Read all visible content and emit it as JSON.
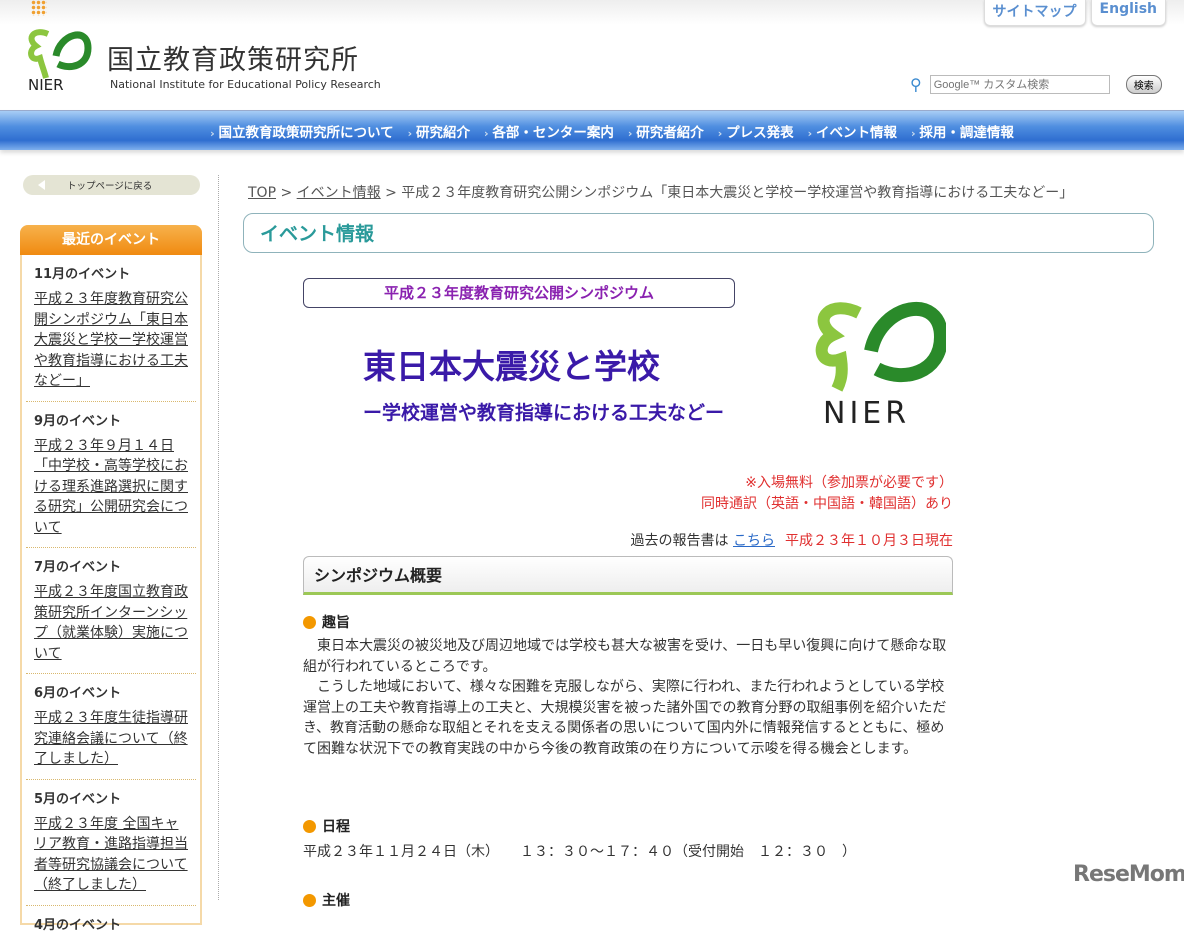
{
  "header": {
    "org_jp": "国立教育政策研究所",
    "org_en": "National Institute for Educational Policy Research",
    "logo_text": "NIER",
    "top_links": [
      "サイトマップ",
      "English"
    ],
    "search": {
      "placeholder": "Google™ カスタム検索",
      "button": "検索"
    }
  },
  "nav": [
    "国立教育政策研究所について",
    "研究紹介",
    "各部・センター案内",
    "研究者紹介",
    "プレス発表",
    "イベント情報",
    "採用・調達情報"
  ],
  "sidebar": {
    "back": "トップページに戻る",
    "events_title": "最近のイベント",
    "events": [
      {
        "month": "11月のイベント",
        "title": "平成２３年度教育研究公開シンポジウム「東日本大震災と学校ー学校運営や教育指導における工夫などー」"
      },
      {
        "month": "9月のイベント",
        "title": "平成２３年９月１４日「中学校・高等学校における理系進路選択に関する研究」公開研究会について"
      },
      {
        "month": "7月のイベント",
        "title": "平成２３年度国立教育政策研究所インターンシップ（就業体験）実施について"
      },
      {
        "month": "6月のイベント",
        "title": "平成２３年度生徒指導研究連絡会議について（終了しました）"
      },
      {
        "month": "5月のイベント",
        "title": "平成２３年度 全国キャリア教育・進路指導担当者等研究協議会について（終了しました）"
      },
      {
        "month": "4月のイベント",
        "title": ""
      }
    ]
  },
  "breadcrumb": {
    "top": "TOP",
    "events": "イベント情報",
    "current": "平成２３年度教育研究公開シンポジウム「東日本大震災と学校ー学校運営や教育指導における工夫などー」"
  },
  "section_title": "イベント情報",
  "banner": {
    "subtitle": "平成２３年度教育研究公開シンポジウム",
    "title": "東日本大震災と学校",
    "title2": "ー学校運営や教育指導における工夫などー",
    "logo_text": "NIER"
  },
  "notes": [
    "※入場無料（参加票が必要です）",
    "同時通訳（英語・中国語・韓国語）あり"
  ],
  "past": {
    "prefix": "過去の報告書は",
    "link": "こちら",
    "date": "平成２３年１０月３日現在"
  },
  "overview": {
    "title": "シンポジウム概要",
    "purpose_h": "趣旨",
    "purpose": [
      "　東日本大震災の被災地及び周辺地域では学校も甚大な被害を受け、一日も早い復興に向けて懸命な取組が行われているところです。",
      "　こうした地域において、様々な困難を克服しながら、実際に行われ、また行われようとしている学校運営上の工夫や教育指導上の工夫と、大規模災害を被った諸外国での教育分野の取組事例を紹介いただき、教育活動の懸命な取組とそれを支える関係者の思いについて国内外に情報発信するとともに、極めて困難な状況下での教育実践の中から今後の教育政策の在り方について示唆を得る機会とします。"
    ],
    "schedule_h": "日程",
    "schedule": "平成２３年１１月２４日（木）　　１３：３０～１７：４０（受付開始　１２：３０　）",
    "host_h": "主催"
  },
  "watermark": "ReseMom"
}
